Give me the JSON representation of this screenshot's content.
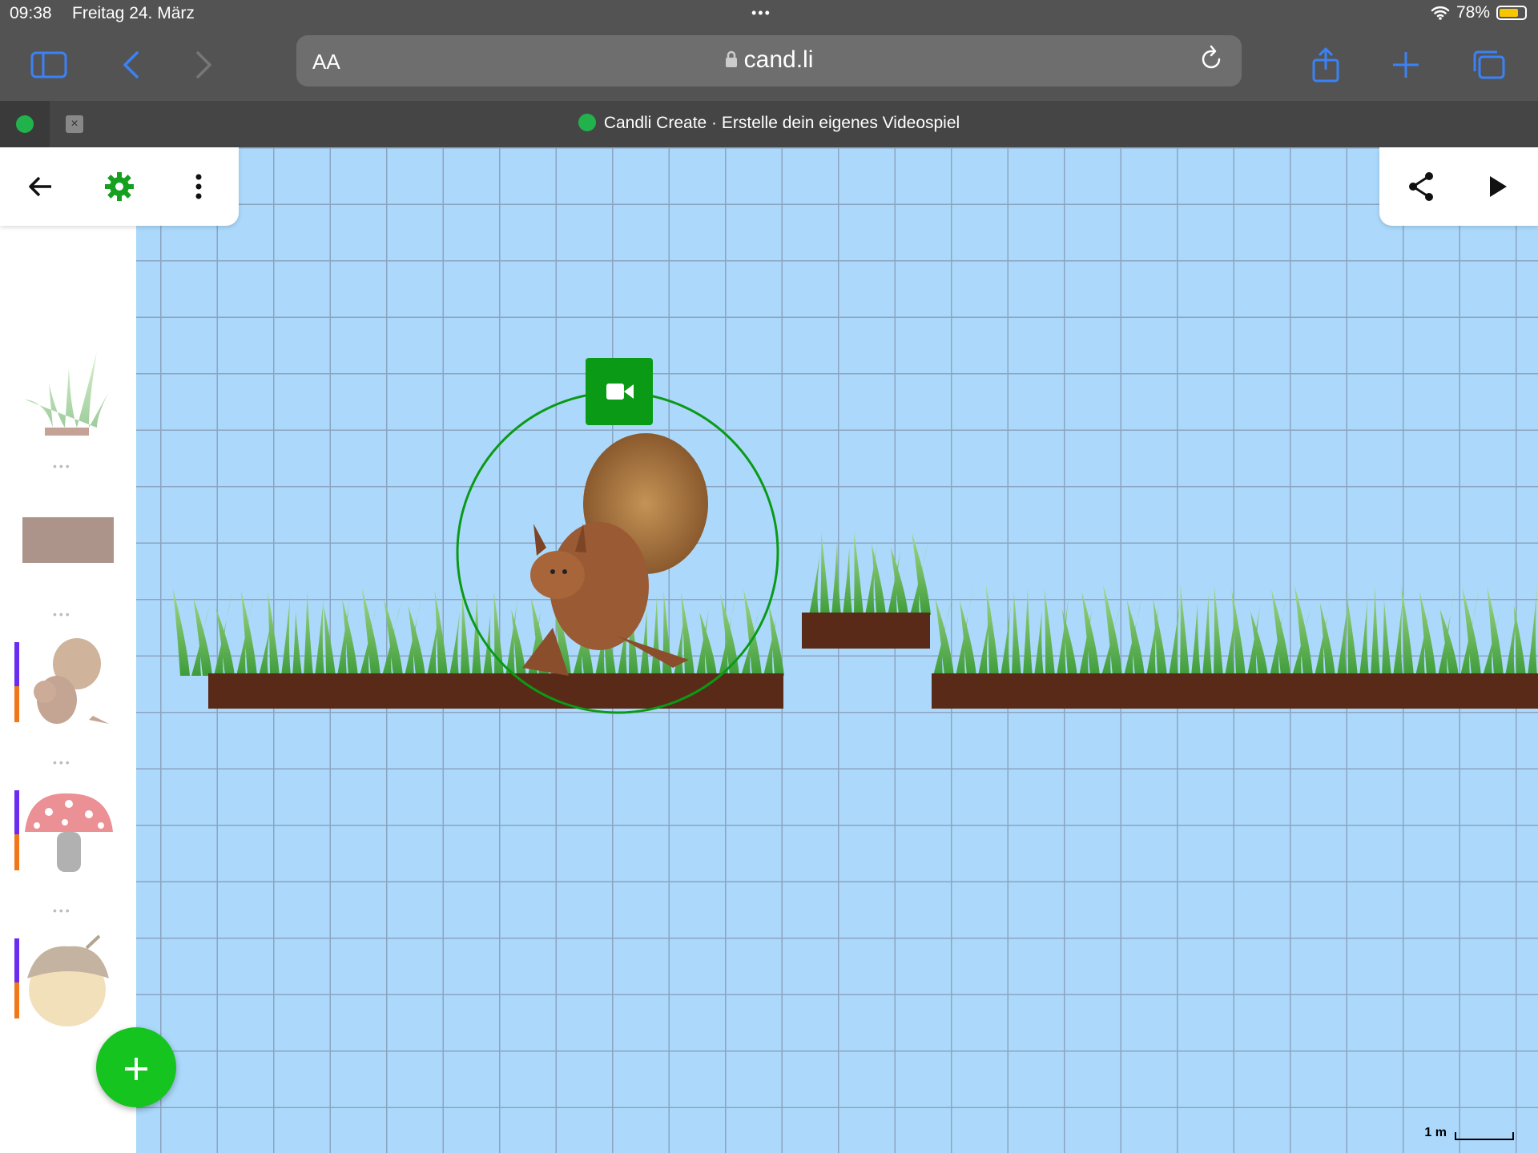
{
  "status": {
    "time": "09:38",
    "date": "Freitag 24. März",
    "dots": "•••",
    "battery": "78%",
    "battery_level": 0.78
  },
  "browser": {
    "text_size": "AA",
    "url": "cand.li",
    "tab_title": "Candli Create · Erstelle dein eigenes Videospiel",
    "tab_close": "×"
  },
  "canvas": {
    "scale_label": "1 m"
  },
  "sidebar": {
    "item_dots": "•••"
  },
  "colors": {
    "accent": "#15c41f",
    "camera": "#0a9a16",
    "grid_bg": "#acd9fb",
    "purple": "#6a2df0",
    "orange": "#f07818"
  }
}
